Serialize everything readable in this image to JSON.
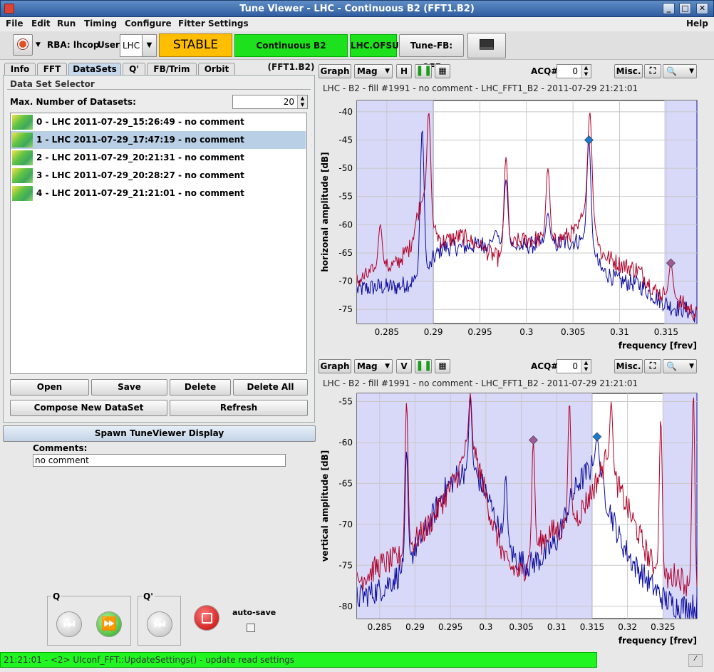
{
  "window": {
    "title": "Tune Viewer - LHC - Continuous B2 (FFT1.B2)",
    "buttons": [
      "_",
      "□",
      "✕"
    ]
  },
  "menubar": {
    "items": [
      "File",
      "Edit",
      "Run",
      "Timing",
      "Configure",
      "Fitter Settings"
    ],
    "help": "Help"
  },
  "toolbar": {
    "rba": "RBA: lhcop",
    "user_label": "User:",
    "user_value": "LHC",
    "stable": "STABLE",
    "continuous": "Continuous B2 (FFT1.B2)",
    "ofsu": "LHC.OFSU",
    "tune_fb": "Tune-FB: OFF"
  },
  "tabs": [
    "Info",
    "FFT",
    "DataSets",
    "Q'",
    "FB/Trim",
    "Orbit"
  ],
  "dataset_selector": {
    "title": "Data Set Selector",
    "max_label": "Max. Number of Datasets:",
    "max_value": "20",
    "items": [
      "0 - LHC 2011-07-29_15:26:49 - no comment",
      "1 - LHC 2011-07-29_17:47:19 - no comment",
      "2 - LHC 2011-07-29_20:21:31 - no comment",
      "3 - LHC 2011-07-29_20:28:27 - no comment",
      "4 - LHC 2011-07-29_21:21:01 - no comment"
    ],
    "buttons": {
      "open": "Open",
      "save": "Save",
      "delete": "Delete",
      "delete_all": "Delete All",
      "compose": "Compose New DataSet",
      "refresh": "Refresh"
    }
  },
  "spawn": "Spawn TuneViewer Display",
  "comments": {
    "label": "Comments:",
    "value": "no comment"
  },
  "bottom": {
    "q": "Q",
    "qprime": "Q'",
    "autosave": "auto-save"
  },
  "status": "21:21:01 - <2> UIconf_FFT::UpdateSettings() - update read settings",
  "plot_controls": {
    "graph": "Graph",
    "mag": "Mag",
    "h": "H",
    "v": "V",
    "acq_label": "ACQ#",
    "acq_value": "0",
    "misc": "Misc."
  },
  "colors": {
    "blue": "#0a0aa0",
    "red": "#b00028",
    "shade": "#d8d8f8",
    "marker_blue": "#1a7ad0",
    "marker_violet": "#a05a9a"
  },
  "chart_data": [
    {
      "type": "line",
      "subtitle": "LHC - B2 - fill #1991 - no comment - LHC_FFT1_B2 - 2011-07-29 21:21:01",
      "xlabel": "frequency [frev]",
      "ylabel": "horizonal amplitude [dB]",
      "xlim": [
        0.2818,
        0.3183
      ],
      "ylim": [
        -77.5,
        -38
      ],
      "xticks": [
        0.285,
        0.29,
        0.295,
        0.3,
        0.305,
        0.31,
        0.315
      ],
      "xtick_labels": [
        "0.285",
        "0.29",
        "0.295",
        "0.3",
        "0.305",
        "0.31",
        "0.315"
      ],
      "yticks": [
        -40,
        -45,
        -50,
        -55,
        -60,
        -65,
        -70,
        -75
      ],
      "shaded_ranges": [
        [
          0.2818,
          0.29
        ],
        [
          0.3148,
          0.3183
        ]
      ],
      "markers": [
        {
          "x": 0.3067,
          "y": -45,
          "color": "#1a7ad0"
        },
        {
          "x": 0.3155,
          "y": -66.8,
          "color": "#a05a9a"
        }
      ],
      "series": [
        {
          "color": "#0a0aa0",
          "base": [
            [
              0.2818,
              -71.5
            ],
            [
              0.284,
              -71
            ],
            [
              0.286,
              -71
            ],
            [
              0.288,
              -70
            ],
            [
              0.2895,
              -68
            ],
            [
              0.29,
              -66
            ],
            [
              0.291,
              -64
            ],
            [
              0.293,
              -64
            ],
            [
              0.295,
              -63.5
            ],
            [
              0.297,
              -63.5
            ],
            [
              0.299,
              -64
            ],
            [
              0.301,
              -63.5
            ],
            [
              0.303,
              -63.5
            ],
            [
              0.305,
              -63
            ],
            [
              0.3065,
              -62.5
            ],
            [
              0.307,
              -64
            ],
            [
              0.308,
              -68
            ],
            [
              0.31,
              -70
            ],
            [
              0.312,
              -70.5
            ],
            [
              0.314,
              -73
            ],
            [
              0.3155,
              -74.5
            ],
            [
              0.317,
              -75
            ],
            [
              0.3183,
              -76
            ]
          ],
          "peaks": [
            [
              0.2888,
              -43
            ],
            [
              0.2967,
              -61
            ],
            [
              0.2978,
              -52
            ],
            [
              0.3023,
              -58
            ],
            [
              0.3067,
              -45
            ]
          ]
        },
        {
          "color": "#b00028",
          "base": [
            [
              0.2818,
              -70
            ],
            [
              0.284,
              -68
            ],
            [
              0.286,
              -67
            ],
            [
              0.2875,
              -64
            ],
            [
              0.2885,
              -57
            ],
            [
              0.289,
              -55
            ],
            [
              0.2895,
              -60
            ],
            [
              0.291,
              -63
            ],
            [
              0.293,
              -62
            ],
            [
              0.295,
              -64
            ],
            [
              0.297,
              -66
            ],
            [
              0.299,
              -63
            ],
            [
              0.301,
              -62.5
            ],
            [
              0.303,
              -63
            ],
            [
              0.3055,
              -61
            ],
            [
              0.3065,
              -56
            ],
            [
              0.307,
              -58
            ],
            [
              0.308,
              -65
            ],
            [
              0.31,
              -67
            ],
            [
              0.312,
              -68
            ],
            [
              0.314,
              -72
            ],
            [
              0.316,
              -73
            ],
            [
              0.3183,
              -76
            ]
          ],
          "peaks": [
            [
              0.2843,
              -60
            ],
            [
              0.2895,
              -40
            ],
            [
              0.2945,
              -65
            ],
            [
              0.2978,
              -48
            ],
            [
              0.3023,
              -50
            ],
            [
              0.3068,
              -40
            ],
            [
              0.3155,
              -66.8
            ]
          ]
        }
      ]
    },
    {
      "type": "line",
      "subtitle": "LHC - B2 - fill #1991 - no comment - LHC_FFT1_B2 - 2011-07-29 21:21:01",
      "xlabel": "frequency [frev]",
      "ylabel": "vertical amplitude [dB]",
      "xlim": [
        0.2818,
        0.3298
      ],
      "ylim": [
        -81.5,
        -54
      ],
      "xticks": [
        0.285,
        0.29,
        0.295,
        0.3,
        0.305,
        0.31,
        0.315,
        0.32,
        0.325
      ],
      "xtick_labels": [
        "0.285",
        "0.29",
        "0.295",
        "0.3",
        "0.305",
        "0.31",
        "0.315",
        "0.32",
        "0.325"
      ],
      "yticks": [
        -55,
        -60,
        -65,
        -70,
        -75,
        -80
      ],
      "shaded_ranges": [
        [
          0.2818,
          0.315
        ],
        [
          0.325,
          0.3298
        ]
      ],
      "markers": [
        {
          "x": 0.3067,
          "y": -59.7,
          "color": "#a05a9a"
        },
        {
          "x": 0.3157,
          "y": -59.3,
          "color": "#1a7ad0"
        }
      ],
      "series": [
        {
          "color": "#0a0aa0",
          "base": [
            [
              0.2818,
              -79
            ],
            [
              0.285,
              -78
            ],
            [
              0.288,
              -76
            ],
            [
              0.29,
              -73
            ],
            [
              0.292,
              -70
            ],
            [
              0.294,
              -66
            ],
            [
              0.296,
              -64
            ],
            [
              0.298,
              -63
            ],
            [
              0.3,
              -66
            ],
            [
              0.302,
              -71
            ],
            [
              0.304,
              -74
            ],
            [
              0.306,
              -75
            ],
            [
              0.308,
              -74
            ],
            [
              0.31,
              -72
            ],
            [
              0.312,
              -67
            ],
            [
              0.313,
              -65
            ],
            [
              0.315,
              -63
            ],
            [
              0.3157,
              -62
            ],
            [
              0.317,
              -67
            ],
            [
              0.319,
              -72
            ],
            [
              0.321,
              -75
            ],
            [
              0.323,
              -77
            ],
            [
              0.325,
              -79
            ],
            [
              0.327,
              -80
            ],
            [
              0.3298,
              -80
            ]
          ],
          "peaks": [
            [
              0.2888,
              -61
            ],
            [
              0.2978,
              -54.5
            ],
            [
              0.3028,
              -64
            ],
            [
              0.3157,
              -59.3
            ]
          ]
        },
        {
          "color": "#b00028",
          "base": [
            [
              0.2818,
              -77
            ],
            [
              0.285,
              -75
            ],
            [
              0.288,
              -74
            ],
            [
              0.29,
              -72
            ],
            [
              0.292,
              -70
            ],
            [
              0.294,
              -67
            ],
            [
              0.296,
              -64
            ],
            [
              0.2975,
              -60
            ],
            [
              0.299,
              -63
            ],
            [
              0.301,
              -70
            ],
            [
              0.303,
              -75
            ],
            [
              0.305,
              -76
            ],
            [
              0.307,
              -73
            ],
            [
              0.309,
              -71
            ],
            [
              0.311,
              -70.5
            ],
            [
              0.313,
              -69
            ],
            [
              0.315,
              -66
            ],
            [
              0.317,
              -62
            ],
            [
              0.319,
              -66
            ],
            [
              0.321,
              -70
            ],
            [
              0.323,
              -74
            ],
            [
              0.325,
              -77
            ],
            [
              0.327,
              -76
            ],
            [
              0.329,
              -78
            ],
            [
              0.3298,
              -79
            ]
          ],
          "peaks": [
            [
              0.2888,
              -55
            ],
            [
              0.2978,
              -54
            ],
            [
              0.3067,
              -59.7
            ],
            [
              0.3118,
              -55
            ],
            [
              0.3177,
              -55
            ],
            [
              0.3247,
              -57
            ],
            [
              0.3293,
              -54
            ]
          ]
        }
      ]
    }
  ]
}
